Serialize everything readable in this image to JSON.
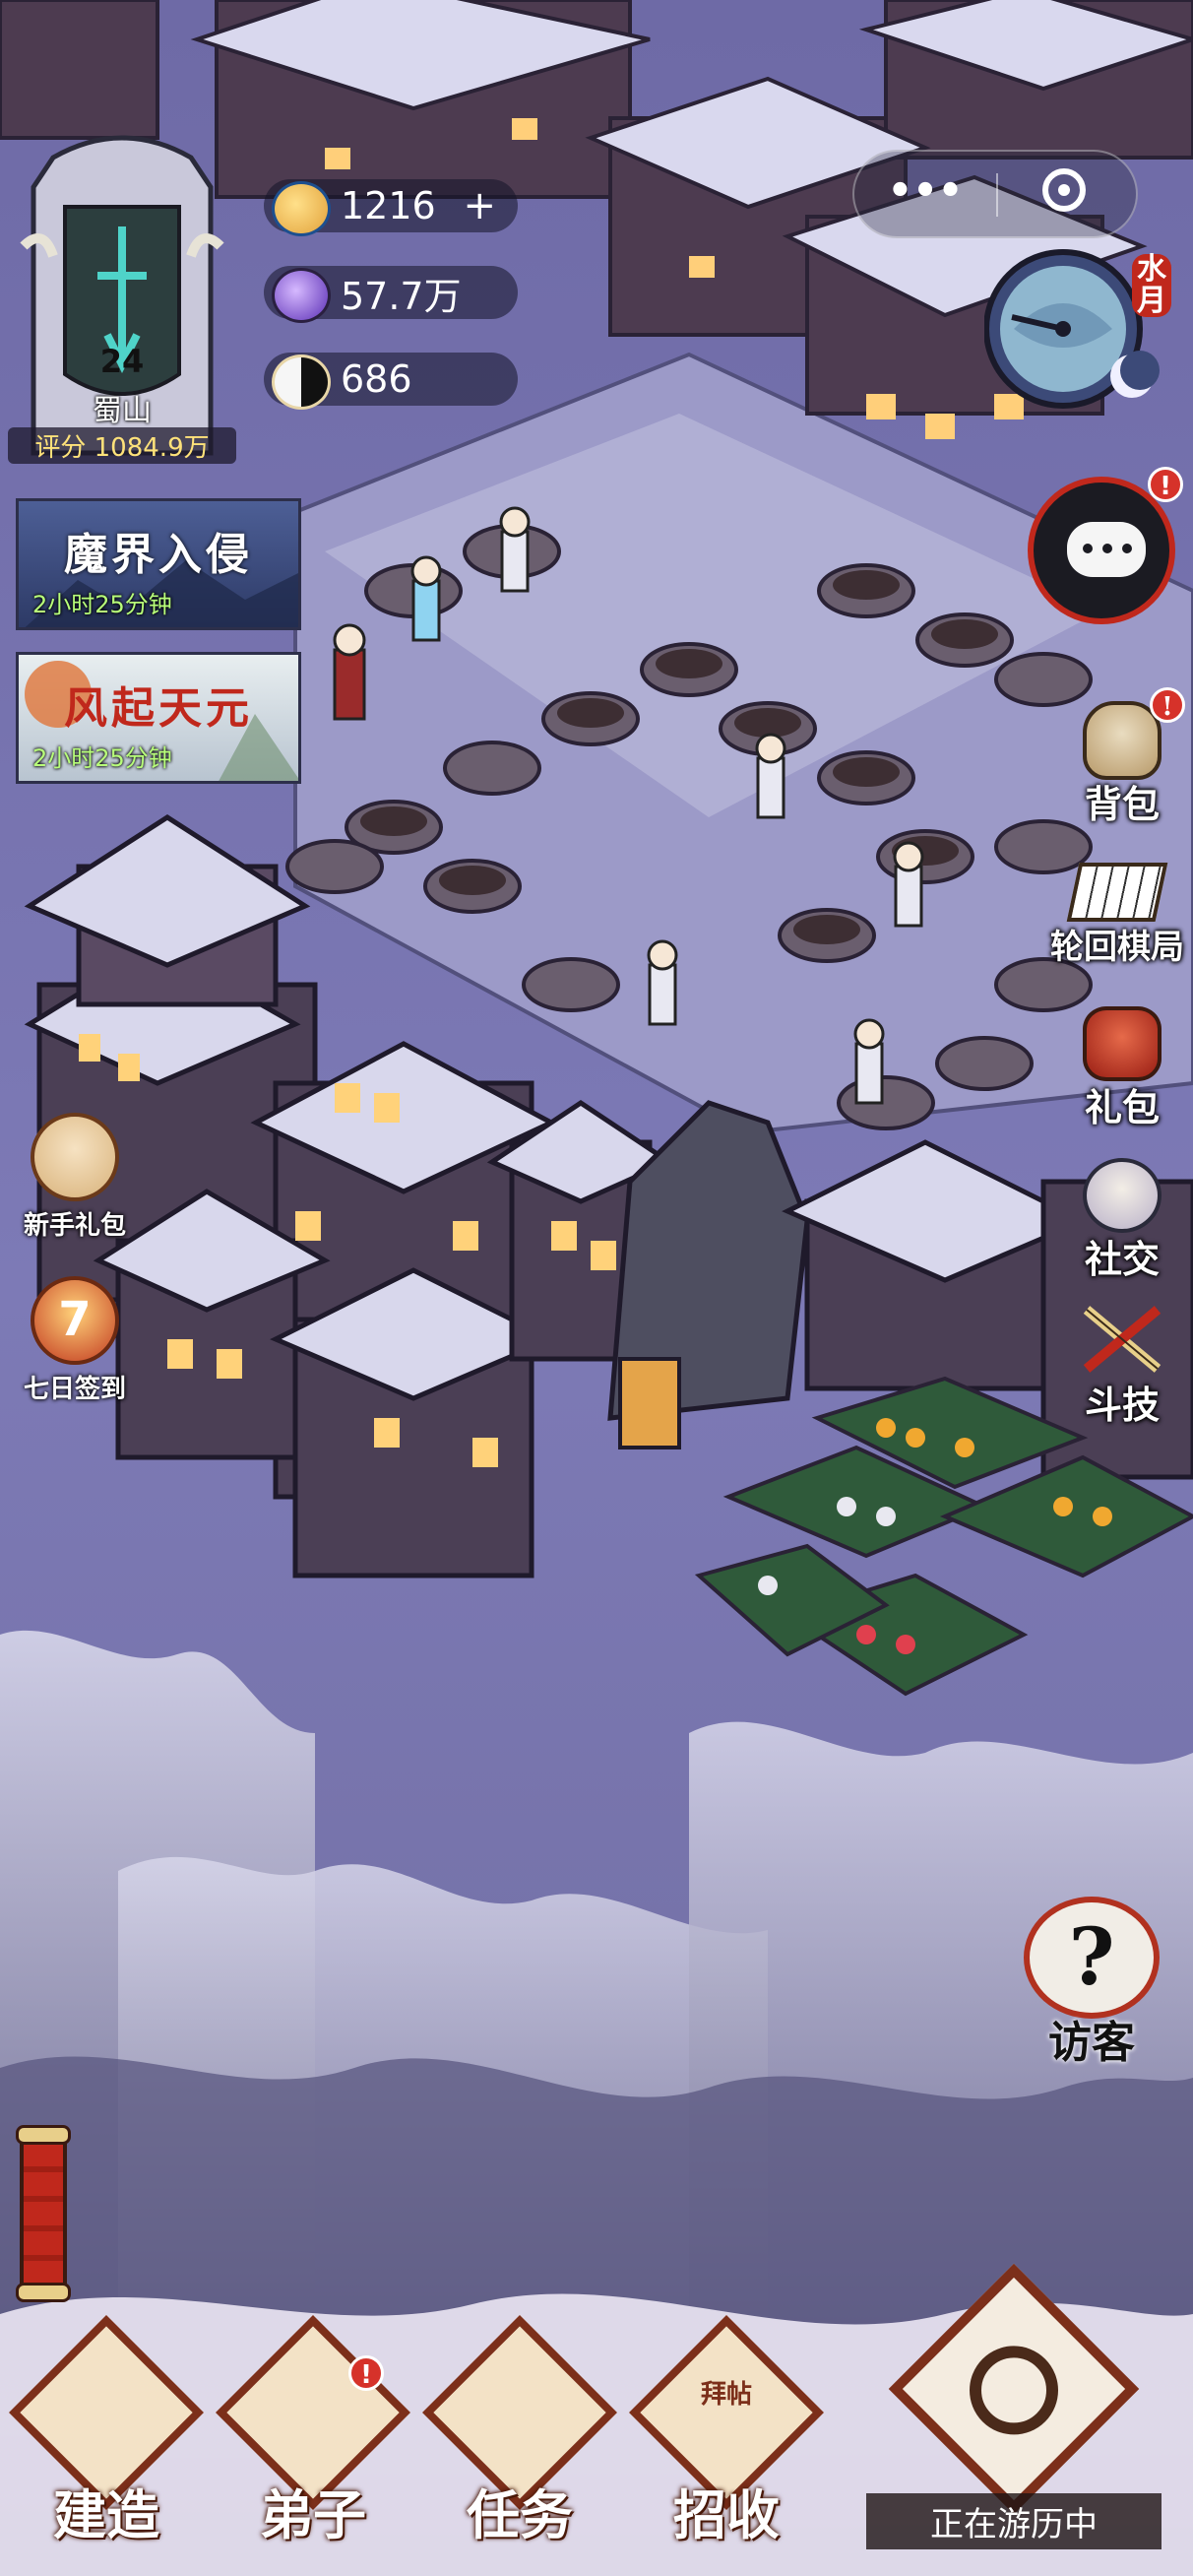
{
  "player": {
    "level": "24",
    "sect_name": "蜀山",
    "score_text": "评分 1084.9万"
  },
  "resources": [
    {
      "icon": "spirit-coin-icon",
      "value": "1216",
      "plus": "+"
    },
    {
      "icon": "crystal-gem-icon",
      "value": "57.7万"
    },
    {
      "icon": "yin-yang-icon",
      "value": "686"
    }
  ],
  "mini_program": {
    "more_icon": "•••",
    "target_icon": "target-icon"
  },
  "calendar": {
    "label": "水月"
  },
  "events": [
    {
      "title": "魔界入侵",
      "timer": "2小时25分钟",
      "colors": {
        "title": "#ffffff",
        "bg": "#3e4f86"
      }
    },
    {
      "title": "风起天元",
      "timer": "2小时25分钟",
      "colors": {
        "title": "#c0281c",
        "bg": "#d7e0e6"
      }
    }
  ],
  "left_buttons": [
    {
      "label": "新手礼包",
      "icon": "newbie-gift-icon"
    },
    {
      "label": "七日签到",
      "icon": "seven-day-checkin-icon"
    }
  ],
  "right_buttons": [
    {
      "label": "背包",
      "icon": "bag-icon",
      "badge": "!"
    },
    {
      "label": "轮回棋局",
      "icon": "chess-board-icon"
    },
    {
      "label": "礼包",
      "icon": "gift-pack-icon"
    },
    {
      "label": "社交",
      "icon": "social-icon"
    },
    {
      "label": "斗技",
      "icon": "crossed-swords-icon"
    }
  ],
  "chat": {
    "icon": "chat-bubble-icon",
    "badge": "!"
  },
  "visitor": {
    "label": "访客",
    "icon": "question-mark-icon"
  },
  "bottom_nav": [
    {
      "label": "建造",
      "icon": "pavilion-icon"
    },
    {
      "label": "弟子",
      "icon": "disciple-icon",
      "badge": "!"
    },
    {
      "label": "任务",
      "icon": "scroll-icon"
    },
    {
      "label": "招收",
      "icon": "recruit-card-icon",
      "card_text": "拜帖"
    }
  ],
  "travel": {
    "label": "正在游历中",
    "icon": "swirl-sword-icon"
  },
  "scroll_item": {
    "icon": "rolled-scroll-icon"
  },
  "colors": {
    "sky": "#7b78b4",
    "accent_red": "#c0281c",
    "badge_red": "#d6322a",
    "timer_green": "#b8ff7a"
  }
}
